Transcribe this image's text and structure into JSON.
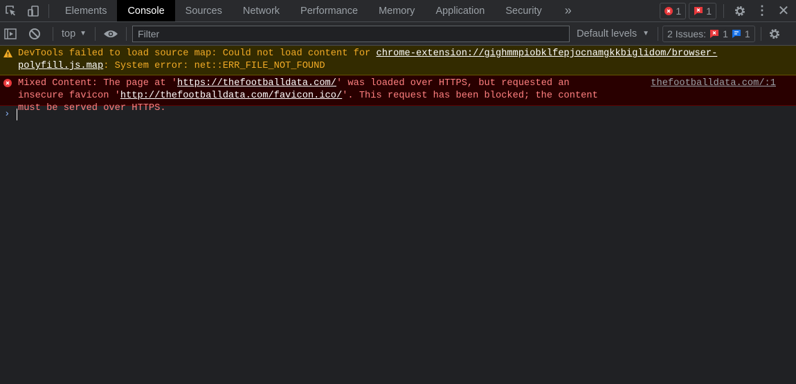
{
  "tabs": [
    {
      "label": "Elements"
    },
    {
      "label": "Console",
      "active": true
    },
    {
      "label": "Sources"
    },
    {
      "label": "Network"
    },
    {
      "label": "Performance"
    },
    {
      "label": "Memory"
    },
    {
      "label": "Application"
    },
    {
      "label": "Security"
    }
  ],
  "header": {
    "error_count": "1",
    "issue_count": "1"
  },
  "toolbar": {
    "context": "top",
    "filter_placeholder": "Filter",
    "levels": "Default levels",
    "issues_label": "2 Issues:",
    "issues_error": "1",
    "issues_info": "1"
  },
  "messages": [
    {
      "level": "warning",
      "t1": "DevTools failed to load source map: Could not load content for ",
      "link": "chrome-extension://gighmmpiobklfepjocnamgkkbiglidom/browser-polyfill.js.map",
      "t2": ": System error: net::ERR_FILE_NOT_FOUND"
    },
    {
      "level": "error",
      "t1": "Mixed Content: The page at '",
      "link1": "https://thefootballdata.com/",
      "t2": "' was loaded over HTTPS, but requested an insecure favicon '",
      "link2": "http://thefootballdata.com/favicon.ico/",
      "t3": "'. This request has been blocked; the content must be served over HTTPS.",
      "source": "thefootballdata.com/:1"
    }
  ],
  "colors": {
    "warning_bg": "#332b00",
    "warning_text": "#f2ab26",
    "error_bg": "#290000",
    "error_text": "#ff8080",
    "accent": "#8ab4f8"
  }
}
